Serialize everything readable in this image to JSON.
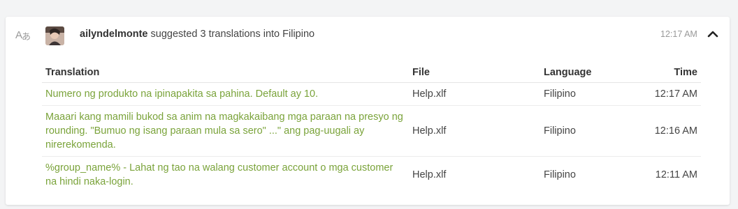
{
  "activity": {
    "user": "ailyndelmonte",
    "action": "suggested 3 translations into Filipino",
    "time": "12:17 AM"
  },
  "icons": {
    "type_icon": "translate-icon",
    "collapse_icon": "chevron-up-icon"
  },
  "table": {
    "headers": {
      "translation": "Translation",
      "file": "File",
      "language": "Language",
      "time": "Time"
    },
    "rows": [
      {
        "translation": "Numero ng produkto na ipinapakita sa pahina. Default ay 10.",
        "file": "Help.xlf",
        "language": "Filipino",
        "time": "12:17 AM"
      },
      {
        "translation": "Maaari kang mamili bukod sa anim na magkakaibang mga paraan na presyo ng rounding. \"Bumuo ng isang paraan mula sa sero\" ...\" ang pag-uugali ay nirerekomenda.",
        "file": "Help.xlf",
        "language": "Filipino",
        "time": "12:16 AM"
      },
      {
        "translation": "%group_name% - Lahat ng tao na walang customer account o mga customer na hindi naka-login.",
        "file": "Help.xlf",
        "language": "Filipino",
        "time": "12:11 AM"
      }
    ]
  },
  "colors": {
    "translation_text": "#7aa33a",
    "muted": "#999999"
  }
}
